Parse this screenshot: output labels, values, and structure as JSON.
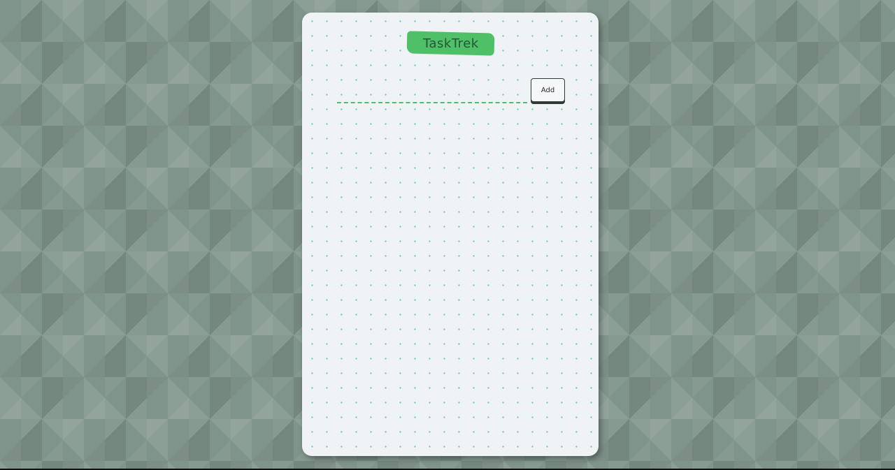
{
  "app": {
    "title": "TaskTrek"
  },
  "task_form": {
    "input_value": "",
    "input_placeholder": "",
    "add_label": "Add"
  },
  "colors": {
    "accent": "#4fbf68",
    "brand_text": "#24543a",
    "card_background": "#f0f3f6",
    "dot_grid": "#6fcfa5",
    "page_background": "#7f948a"
  },
  "task_list": {
    "items": []
  }
}
